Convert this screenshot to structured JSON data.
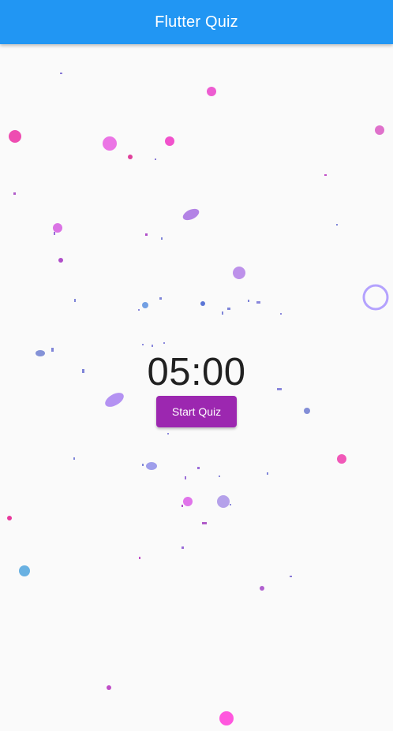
{
  "app_bar": {
    "title": "Flutter Quiz",
    "color": "#2196f3"
  },
  "timer": {
    "display": "05:00"
  },
  "start_button": {
    "label": "Start Quiz",
    "color": "#9c27b0"
  },
  "confetti_colors": [
    "#e040fb",
    "#b388ff",
    "#7986cb",
    "#4fc3f7",
    "#ab47bc",
    "#ff4081"
  ]
}
